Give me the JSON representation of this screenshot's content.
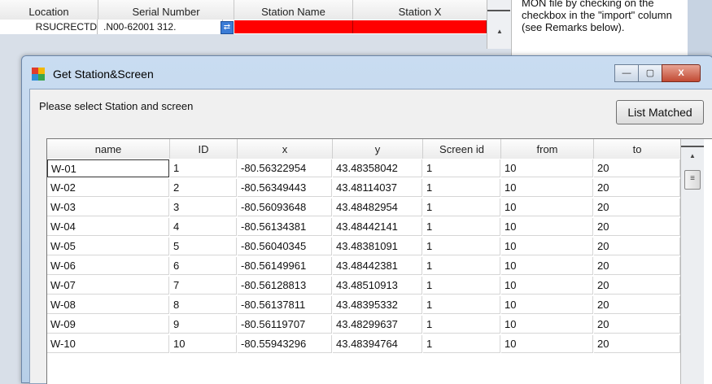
{
  "background_grid": {
    "columns": [
      "Location",
      "Serial Number",
      "Station Name",
      "Station X"
    ],
    "row": {
      "location": "RSUCRECTD",
      "serial": ".N00-62001 312."
    },
    "highlight_color": "#ff0000"
  },
  "help_text": "MON file by checking on the checkbox in the \"import\" column (see Remarks below).",
  "dialog": {
    "title": "Get Station&Screen",
    "prompt": "Please select Station and screen",
    "list_button": "List Matched",
    "minimize": "—",
    "maximize": "▢",
    "close": "X"
  },
  "table": {
    "columns": [
      "name",
      "ID",
      "x",
      "y",
      "Screen id",
      "from",
      "to"
    ],
    "rows": [
      [
        "W-01",
        "1",
        "-80.56322954",
        "43.48358042",
        "1",
        "10",
        "20"
      ],
      [
        "W-02",
        "2",
        "-80.56349443",
        "43.48114037",
        "1",
        "10",
        "20"
      ],
      [
        "W-03",
        "3",
        "-80.56093648",
        "43.48482954",
        "1",
        "10",
        "20"
      ],
      [
        "W-04",
        "4",
        "-80.56134381",
        "43.48442141",
        "1",
        "10",
        "20"
      ],
      [
        "W-05",
        "5",
        "-80.56040345",
        "43.48381091",
        "1",
        "10",
        "20"
      ],
      [
        "W-06",
        "6",
        "-80.56149961",
        "43.48442381",
        "1",
        "10",
        "20"
      ],
      [
        "W-07",
        "7",
        "-80.56128813",
        "43.48510913",
        "1",
        "10",
        "20"
      ],
      [
        "W-08",
        "8",
        "-80.56137811",
        "43.48395332",
        "1",
        "10",
        "20"
      ],
      [
        "W-09",
        "9",
        "-80.56119707",
        "43.48299637",
        "1",
        "10",
        "20"
      ],
      [
        "W-10",
        "10",
        "-80.55943296",
        "43.48394764",
        "1",
        "10",
        "20"
      ]
    ]
  }
}
